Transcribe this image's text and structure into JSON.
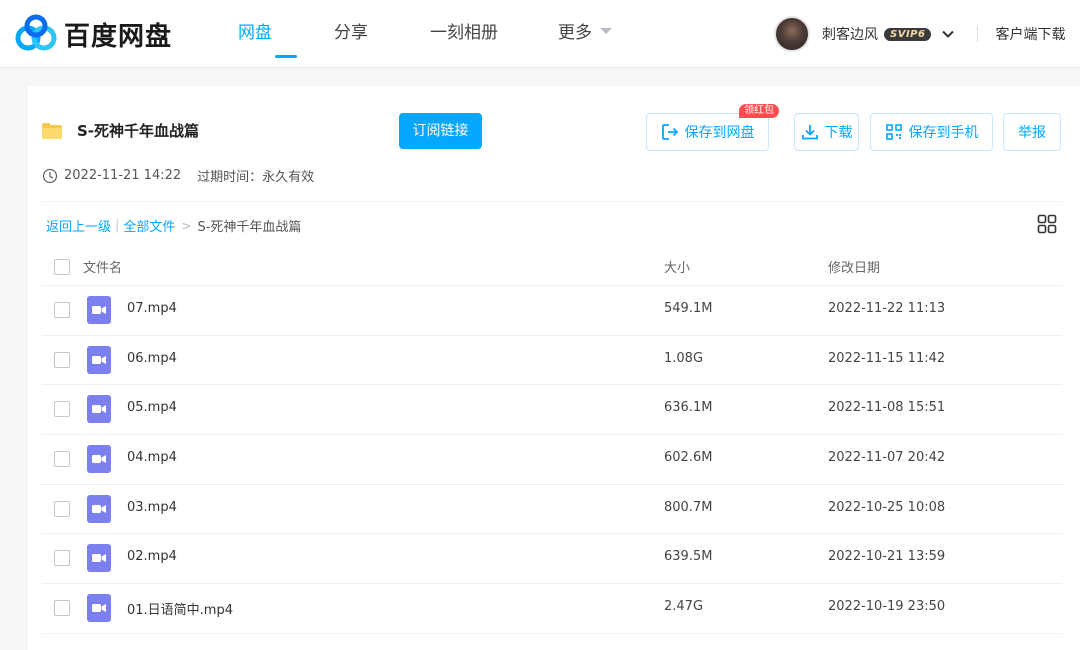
{
  "app": {
    "logo_text": "百度网盘"
  },
  "nav": {
    "items": [
      {
        "label": "网盘",
        "active": true
      },
      {
        "label": "分享",
        "active": false
      },
      {
        "label": "一刻相册",
        "active": false
      },
      {
        "label": "更多",
        "active": false
      }
    ]
  },
  "user": {
    "name": "刺客边风",
    "badge": "SVIP6",
    "client_download": "客户端下载"
  },
  "share": {
    "name": "S-死神千年血战篇",
    "subscribe_label": "订阅链接",
    "created": "2022-11-21 14:22",
    "expire": "过期时间：永久有效"
  },
  "actions": {
    "save_to_disk": "保存到网盘",
    "download": "下载",
    "save_to_phone": "保存到手机",
    "report": "举报",
    "redpacket": "领红包"
  },
  "breadcrumb": {
    "back": "返回上一级",
    "all": "全部文件",
    "current": "S-死神千年血战篇"
  },
  "table": {
    "headers": {
      "name": "文件名",
      "size": "大小",
      "date": "修改日期"
    },
    "rows": [
      {
        "name": "07.mp4",
        "size": "549.1M",
        "date": "2022-11-22 11:13"
      },
      {
        "name": "06.mp4",
        "size": "1.08G",
        "date": "2022-11-15 11:42"
      },
      {
        "name": "05.mp4",
        "size": "636.1M",
        "date": "2022-11-08 15:51"
      },
      {
        "name": "04.mp4",
        "size": "602.6M",
        "date": "2022-11-07 20:42"
      },
      {
        "name": "03.mp4",
        "size": "800.7M",
        "date": "2022-10-25 10:08"
      },
      {
        "name": "02.mp4",
        "size": "639.5M",
        "date": "2022-10-21 13:59"
      },
      {
        "name": "01.日语简中.mp4",
        "size": "2.47G",
        "date": "2022-10-19 23:50"
      }
    ]
  },
  "colors": {
    "accent": "#06a7ff",
    "video_icon": "#7b7ff0",
    "redpacket": "#ff4d4f"
  }
}
